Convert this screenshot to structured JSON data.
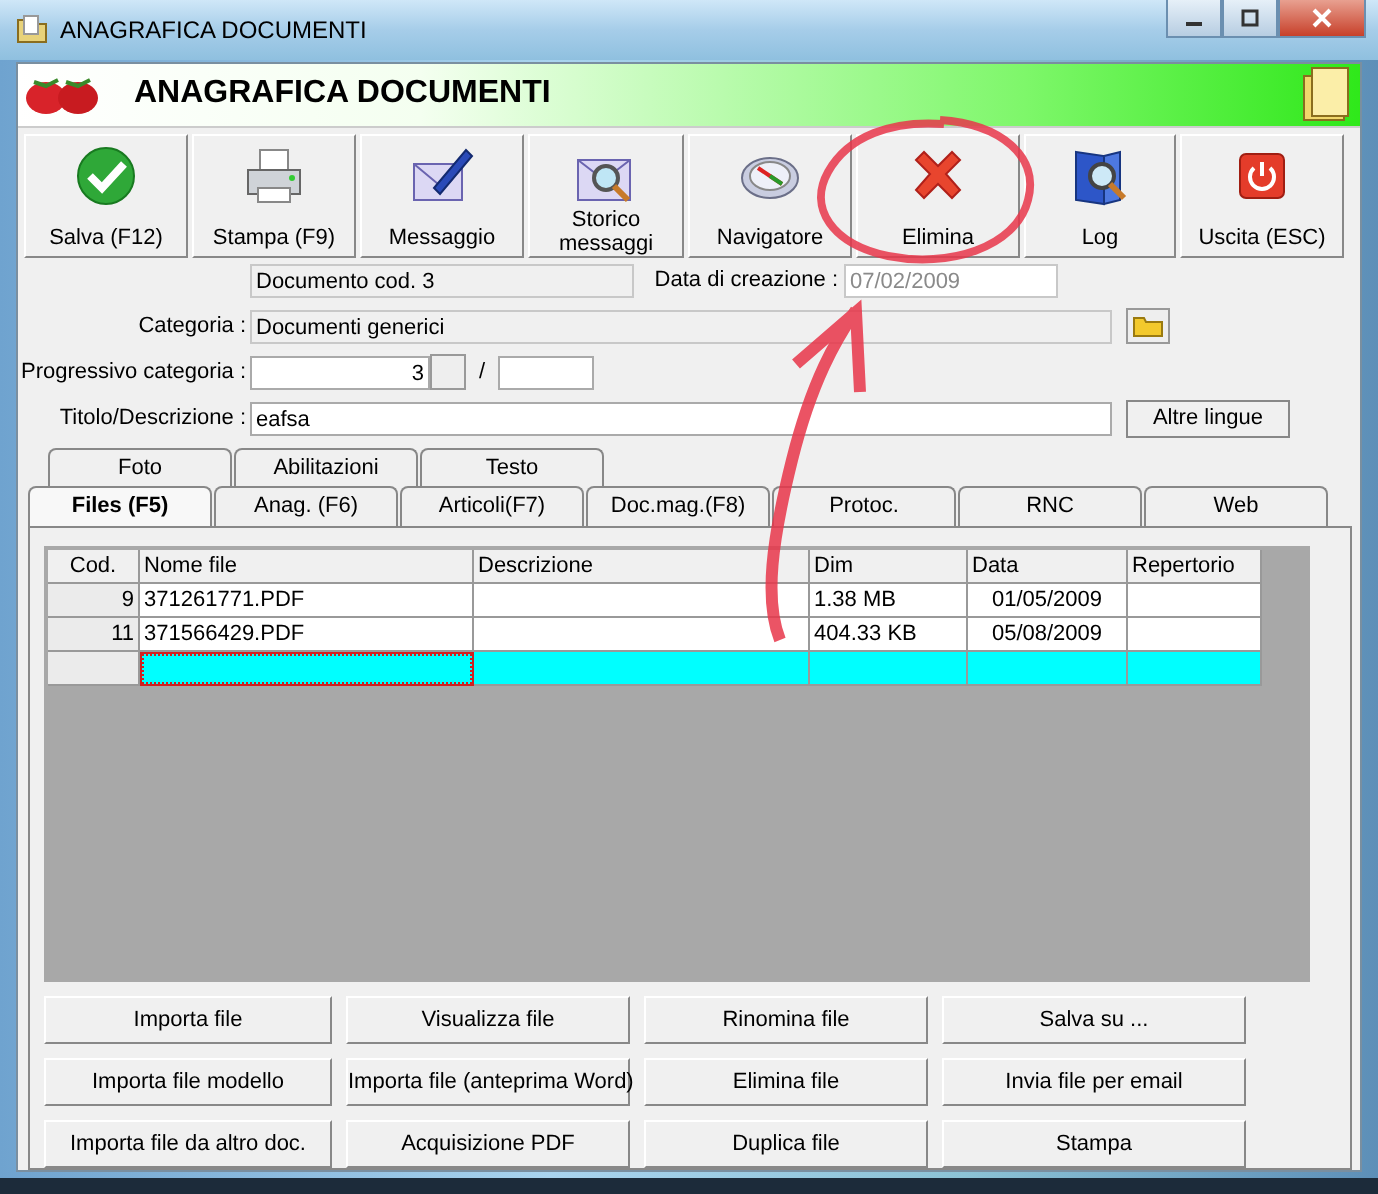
{
  "window": {
    "title": "ANAGRAFICA DOCUMENTI"
  },
  "header": {
    "title": "ANAGRAFICA DOCUMENTI"
  },
  "toolbar": [
    {
      "label": "Salva (F12)"
    },
    {
      "label": "Stampa (F9)"
    },
    {
      "label": "Messaggio"
    },
    {
      "label": "Storico messaggi"
    },
    {
      "label": "Navigatore"
    },
    {
      "label": "Elimina"
    },
    {
      "label": "Log"
    },
    {
      "label": "Uscita (ESC)"
    }
  ],
  "form": {
    "document_code": {
      "value": "Documento cod. 3",
      "disabled": true
    },
    "creation_date": {
      "label": "Data di creazione :",
      "value": "07/02/2009",
      "disabled": true
    },
    "category": {
      "label": "Categoria :",
      "value": "Documenti generici",
      "disabled": true
    },
    "progressive": {
      "label": "Progressivo categoria :",
      "value": "3",
      "separator": "/"
    },
    "title": {
      "label": "Titolo/Descrizione :",
      "value": "eafsa"
    },
    "other_languages_button": "Altre lingue"
  },
  "tabs_back": [
    {
      "label": "Foto",
      "selected": false
    },
    {
      "label": "Abilitazioni",
      "selected": false
    },
    {
      "label": "Testo",
      "selected": false
    }
  ],
  "tabs_front": [
    {
      "label": "Files (F5)",
      "selected": true
    },
    {
      "label": "Anag. (F6)",
      "selected": false
    },
    {
      "label": "Articoli(F7)",
      "selected": false
    },
    {
      "label": "Doc.mag.(F8)",
      "selected": false
    },
    {
      "label": "Protoc.",
      "selected": false
    },
    {
      "label": "RNC",
      "selected": false
    },
    {
      "label": "Web",
      "selected": false
    }
  ],
  "table": {
    "columns": [
      "Cod.",
      "Nome file",
      "Descrizione",
      "Dim",
      "Data",
      "Repertorio"
    ],
    "rows": [
      {
        "cells": [
          "9",
          "371261771.PDF",
          "",
          "1.38 MB",
          "01/05/2009",
          ""
        ],
        "selected": false
      },
      {
        "cells": [
          "11",
          "371566429.PDF",
          "",
          "404.33 KB",
          "05/08/2009",
          ""
        ],
        "selected": false
      },
      {
        "cells": [
          "",
          "",
          "",
          "",
          "",
          ""
        ],
        "selected": true
      }
    ]
  },
  "file_buttons": [
    "Importa file",
    "Visualizza file",
    "Rinomina file",
    "Salva su ...",
    "Importa file modello",
    "Importa file (anteprima Word)",
    "Elimina file",
    "Invia file per email",
    "Importa file da altro doc.",
    "Acquisizione PDF",
    "Duplica file",
    "Stampa"
  ],
  "annotation": {
    "circle": true,
    "arrow": true
  }
}
